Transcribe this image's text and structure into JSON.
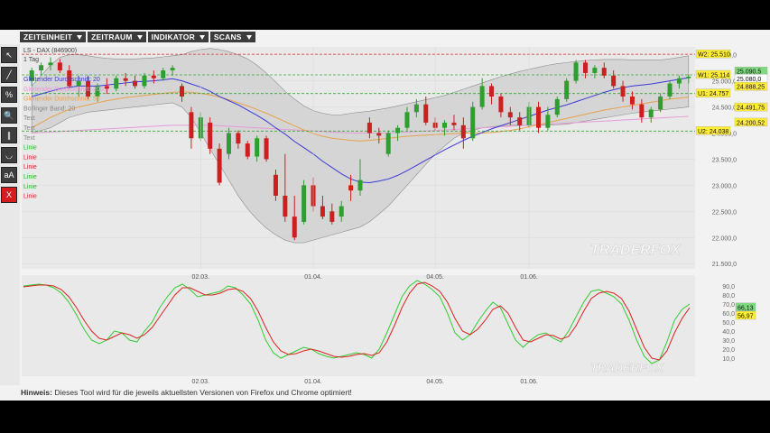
{
  "menu": [
    "ZEITEINHEIT",
    "ZEITRAUM",
    "INDIKATOR",
    "SCANS"
  ],
  "tools": [
    {
      "name": "cursor-icon",
      "glyph": "↖"
    },
    {
      "name": "line-tool-icon",
      "glyph": "╱"
    },
    {
      "name": "percent-tool-icon",
      "glyph": "%"
    },
    {
      "name": "zoom-icon",
      "glyph": "🔍"
    },
    {
      "name": "parallel-lines-icon",
      "glyph": "∥"
    },
    {
      "name": "arc-tool-icon",
      "glyph": "◡"
    },
    {
      "name": "text-tool-icon",
      "glyph": "aA"
    },
    {
      "name": "delete-icon",
      "glyph": "X"
    }
  ],
  "hint": {
    "label": "Hinweis:",
    "text": " Dieses Tool wird für die jeweils aktuellsten Versionen von Firefox und Chrome optimiert!"
  },
  "colors": {
    "up": "#2e9e2e",
    "down": "#cc1f1f",
    "sma20": "#3a3ad6",
    "sma200": "#e8a24a",
    "bollinger": "#bcbcbc",
    "stoch_k": "#33cc33",
    "stoch_d": "#dd2222",
    "pink": "#e89ad8"
  },
  "chart_data": {
    "type": "candlestick",
    "instrument": "LS - DAX (846900)",
    "timeframe": "1 Tag",
    "legend": [
      {
        "text": "Gleitender Durchschnitt: 20",
        "color": "#3a3ad6"
      },
      {
        "text": "Gleitender Durchschnitt: 200",
        "color": "#e89ad8"
      },
      {
        "text": "Gleitender Durchschnitt: 50",
        "color": "#e8a24a"
      },
      {
        "text": "Bollinger Band: 20",
        "color": "#888"
      },
      {
        "text": "Text",
        "color": "#888"
      },
      {
        "text": "Text",
        "color": "#888"
      },
      {
        "text": "Text",
        "color": "#888"
      },
      {
        "text": "Linie",
        "color": "#22bb22"
      },
      {
        "text": "Linie",
        "color": "#dd2222"
      },
      {
        "text": "Linie",
        "color": "#dd2222"
      },
      {
        "text": "Linie",
        "color": "#22bb22"
      },
      {
        "text": "Linie",
        "color": "#22bb22"
      },
      {
        "text": "Linie",
        "color": "#dd2222"
      }
    ],
    "x_labels": [
      "02.03.",
      "01.04.",
      "04.05.",
      "01.06."
    ],
    "x_label_index": [
      18,
      30,
      43,
      53
    ],
    "y_ticks": [
      21500,
      22000,
      22500,
      23000,
      23500,
      24000,
      24500,
      25000,
      25500
    ],
    "y_tick_labels": [
      "21.500,0",
      "22.000,0",
      "22.500,0",
      "23.000,0",
      "23.500,0",
      "24.000,0",
      "24.500,0",
      "25.000,0",
      "25.550,0"
    ],
    "ylim": [
      21400,
      25650
    ],
    "levels": [
      {
        "label": "W2: 25.510",
        "value": 25510,
        "color": "#dd3333",
        "bg": "#ffee33"
      },
      {
        "label": "W1: 25.114",
        "value": 25114,
        "color": "#33aa33",
        "bg": "#ffee33"
      },
      {
        "label": "U1: 24.757",
        "value": 24757,
        "color": "#33aa33",
        "bg": "#ffee33"
      },
      {
        "label": "U2: 24.038",
        "value": 24038,
        "color": "#33aa33",
        "bg": "#ffee33"
      }
    ],
    "price_tags": [
      {
        "label": "25.090,5",
        "value": 25180,
        "bg": "#7fd97f"
      },
      {
        "label": "25.080,0",
        "value": 25040,
        "bg": "#ffffff"
      },
      {
        "label": "24.888,25",
        "value": 24888,
        "bg": "#ffee33"
      },
      {
        "label": "24.491,75",
        "value": 24491,
        "bg": "#ffee33"
      },
      {
        "label": "24.200,52",
        "value": 24200,
        "bg": "#ffee33"
      }
    ],
    "candles": [
      [
        25000,
        25250,
        24900,
        25200
      ],
      [
        25200,
        25350,
        25100,
        25300
      ],
      [
        25300,
        25450,
        25200,
        25350
      ],
      [
        25350,
        25420,
        25150,
        25200
      ],
      [
        25200,
        25300,
        24850,
        24900
      ],
      [
        24900,
        25100,
        24700,
        25000
      ],
      [
        25000,
        25100,
        24650,
        24700
      ],
      [
        24700,
        24950,
        24600,
        24900
      ],
      [
        24900,
        25050,
        24750,
        24850
      ],
      [
        24850,
        25100,
        24800,
        25050
      ],
      [
        25050,
        25150,
        24900,
        25000
      ],
      [
        25000,
        25100,
        24850,
        24900
      ],
      [
        24900,
        25150,
        24850,
        25100
      ],
      [
        25100,
        25200,
        24950,
        25050
      ],
      [
        25050,
        25250,
        25000,
        25200
      ],
      [
        25200,
        25300,
        25100,
        25250
      ],
      [
        24900,
        24950,
        24600,
        24700
      ],
      [
        24400,
        24500,
        23700,
        23900
      ],
      [
        23900,
        24400,
        23850,
        24300
      ],
      [
        24200,
        24300,
        23600,
        23700
      ],
      [
        23700,
        23800,
        23000,
        23050
      ],
      [
        23600,
        24100,
        23500,
        24000
      ],
      [
        24000,
        24050,
        23700,
        23800
      ],
      [
        23800,
        23850,
        23500,
        23550
      ],
      [
        23550,
        23950,
        23450,
        23900
      ],
      [
        23900,
        23950,
        23450,
        23500
      ],
      [
        23200,
        23300,
        22700,
        22800
      ],
      [
        22800,
        23600,
        22300,
        22400
      ],
      [
        22400,
        22800,
        21950,
        22000
      ],
      [
        22300,
        23100,
        22250,
        23000
      ],
      [
        23000,
        23150,
        22500,
        22600
      ],
      [
        22600,
        22800,
        22350,
        22400
      ],
      [
        22500,
        22650,
        22250,
        22300
      ],
      [
        22400,
        22700,
        22300,
        22600
      ],
      [
        23000,
        23200,
        22700,
        22900
      ],
      [
        22900,
        23500,
        22800,
        23100
      ],
      [
        24200,
        24300,
        23900,
        24000
      ],
      [
        24000,
        24100,
        23800,
        23950
      ],
      [
        23600,
        24050,
        23550,
        24000
      ],
      [
        24000,
        24150,
        23850,
        24100
      ],
      [
        24100,
        24500,
        24050,
        24400
      ],
      [
        24400,
        24650,
        24300,
        24550
      ],
      [
        24550,
        24700,
        24150,
        24200
      ],
      [
        24200,
        24300,
        24050,
        24100
      ],
      [
        24100,
        24250,
        23950,
        24200
      ],
      [
        24200,
        24350,
        24050,
        24150
      ],
      [
        24150,
        24300,
        23700,
        23900
      ],
      [
        23900,
        24600,
        23850,
        24500
      ],
      [
        24500,
        25050,
        24450,
        24900
      ],
      [
        24900,
        24950,
        24550,
        24700
      ],
      [
        24700,
        24750,
        24300,
        24400
      ],
      [
        24400,
        24500,
        24150,
        24300
      ],
      [
        24300,
        24400,
        24050,
        24150
      ],
      [
        24150,
        24600,
        24100,
        24500
      ],
      [
        24500,
        24600,
        24000,
        24100
      ],
      [
        24100,
        24500,
        24050,
        24350
      ],
      [
        24350,
        24700,
        24300,
        24650
      ],
      [
        24650,
        25050,
        24600,
        25000
      ],
      [
        25000,
        25400,
        24950,
        25350
      ],
      [
        25350,
        25400,
        25050,
        25150
      ],
      [
        25150,
        25300,
        25050,
        25250
      ],
      [
        25250,
        25350,
        25050,
        25100
      ],
      [
        25100,
        25200,
        24850,
        24900
      ],
      [
        24900,
        25000,
        24600,
        24700
      ],
      [
        24700,
        24800,
        24450,
        24550
      ],
      [
        24550,
        24650,
        24200,
        24300
      ],
      [
        24300,
        24500,
        24200,
        24450
      ],
      [
        24450,
        24750,
        24400,
        24700
      ],
      [
        24700,
        25000,
        24650,
        24950
      ],
      [
        24950,
        25100,
        24850,
        25050
      ],
      [
        25050,
        25120,
        24950,
        25080
      ]
    ],
    "sma20": [
      24700,
      24750,
      24800,
      24850,
      24880,
      24900,
      24900,
      24900,
      24920,
      24940,
      24960,
      24980,
      24990,
      25000,
      25020,
      25040,
      25000,
      24940,
      24880,
      24800,
      24700,
      24620,
      24540,
      24440,
      24340,
      24230,
      24100,
      23980,
      23840,
      23720,
      23600,
      23460,
      23340,
      23220,
      23120,
      23060,
      23050,
      23080,
      23120,
      23190,
      23280,
      23380,
      23480,
      23580,
      23680,
      23770,
      23860,
      23940,
      24010,
      24080,
      24140,
      24200,
      24260,
      24320,
      24380,
      24440,
      24490,
      24540,
      24600,
      24660,
      24720,
      24780,
      24830,
      24870,
      24900,
      24920,
      24940,
      24970,
      25000,
      25030,
      25060
    ],
    "sma50": [
      24100,
      24200,
      24300,
      24380,
      24450,
      24500,
      24540,
      24580,
      24620,
      24650,
      24680,
      24700,
      24720,
      24740,
      24760,
      24780,
      24790,
      24780,
      24760,
      24730,
      24690,
      24640,
      24580,
      24520,
      24450,
      24380,
      24300,
      24220,
      24140,
      24060,
      23990,
      23940,
      23900,
      23880,
      23860,
      23850,
      23860,
      23880,
      23900,
      23920,
      23940,
      23950,
      23960,
      23970,
      23980,
      23990,
      24000,
      24000,
      24000,
      24010,
      24030,
      24050,
      24080,
      24120,
      24160,
      24200,
      24240,
      24280,
      24320,
      24360,
      24400,
      24440,
      24470,
      24500,
      24530,
      24560,
      24590,
      24620,
      24650,
      24670,
      24690
    ],
    "sma200": [
      24000,
      24010,
      24020,
      24030,
      24040,
      24050,
      24060,
      24070,
      24080,
      24090,
      24100,
      24110,
      24120,
      24130,
      24140,
      24150,
      24150,
      24150,
      24150,
      24150,
      24140,
      24130,
      24120,
      24110,
      24100,
      24090,
      24080,
      24070,
      24060,
      24050,
      24040,
      24030,
      24020,
      24010,
      24000,
      24000,
      24000,
      24000,
      24000,
      24010,
      24020,
      24030,
      24040,
      24050,
      24060,
      24070,
      24080,
      24090,
      24100,
      24110,
      24120,
      24130,
      24140,
      24150,
      24160,
      24170,
      24180,
      24190,
      24200,
      24210,
      24220,
      24230,
      24240,
      24250,
      24260,
      24270,
      24280,
      24290,
      24300,
      24310,
      24320
    ],
    "bb_upper": [
      24900,
      25100,
      25300,
      25450,
      25500,
      25500,
      25480,
      25450,
      25430,
      25420,
      25420,
      25420,
      25430,
      25440,
      25460,
      25480,
      25500,
      25560,
      25600,
      25620,
      25600,
      25560,
      25500,
      25420,
      25300,
      25150,
      24980,
      24800,
      24650,
      24520,
      24430,
      24380,
      24350,
      24350,
      24380,
      24400,
      24420,
      24450,
      24480,
      24520,
      24560,
      24600,
      24640,
      24680,
      24720,
      24780,
      24840,
      24900,
      24960,
      25020,
      25080,
      25130,
      25180,
      25220,
      25260,
      25300,
      25330,
      25350,
      25370,
      25390,
      25400,
      25410,
      25410,
      25410,
      25400,
      25400,
      25400,
      25400,
      25420,
      25450,
      25480
    ],
    "bb_lower": [
      24000,
      24050,
      24100,
      24200,
      24300,
      24350,
      24400,
      24420,
      24440,
      24460,
      24480,
      24500,
      24520,
      24540,
      24560,
      24580,
      24500,
      24300,
      24000,
      23700,
      23400,
      23100,
      22800,
      22550,
      22350,
      22180,
      22050,
      21950,
      21900,
      21900,
      21950,
      22000,
      22050,
      22100,
      22150,
      22200,
      22300,
      22450,
      22600,
      22800,
      23000,
      23200,
      23400,
      23600,
      23750,
      23900,
      24000,
      24050,
      24100,
      24120,
      24140,
      24150,
      24150,
      24150,
      24150,
      24150,
      24160,
      24170,
      24200,
      24230,
      24260,
      24290,
      24320,
      24350,
      24380,
      24400,
      24420,
      24440,
      24460,
      24480,
      24500
    ],
    "stoch_k": [
      90,
      91,
      92,
      91,
      88,
      82,
      72,
      58,
      42,
      30,
      26,
      30,
      40,
      38,
      30,
      28,
      40,
      50,
      66,
      78,
      88,
      92,
      86,
      78,
      80,
      82,
      84,
      90,
      88,
      80,
      70,
      52,
      30,
      16,
      10,
      14,
      18,
      22,
      20,
      15,
      12,
      10,
      12,
      14,
      16,
      14,
      10,
      20,
      38,
      58,
      78,
      90,
      96,
      92,
      86,
      78,
      60,
      38,
      30,
      36,
      50,
      62,
      72,
      66,
      48,
      30,
      22,
      30,
      36,
      38,
      32,
      28,
      40,
      56,
      72,
      84,
      86,
      82,
      78,
      70,
      52,
      30,
      12,
      4,
      8,
      28,
      52,
      64,
      70
    ],
    "stoch_d": [
      89,
      90,
      91,
      91,
      90,
      86,
      78,
      66,
      52,
      40,
      32,
      30,
      34,
      38,
      36,
      32,
      36,
      44,
      56,
      68,
      80,
      88,
      88,
      84,
      80,
      80,
      82,
      86,
      87,
      84,
      76,
      62,
      44,
      28,
      18,
      14,
      15,
      18,
      20,
      18,
      15,
      12,
      11,
      12,
      14,
      15,
      13,
      16,
      28,
      46,
      66,
      82,
      92,
      94,
      90,
      84,
      72,
      54,
      40,
      36,
      42,
      52,
      64,
      68,
      60,
      44,
      30,
      28,
      32,
      36,
      35,
      31,
      34,
      46,
      62,
      76,
      82,
      84,
      82,
      76,
      62,
      42,
      22,
      10,
      8,
      18,
      38,
      54,
      66
    ],
    "stoch_yticks": [
      "90,0",
      "80,0",
      "70,0",
      "60,0",
      "50,0",
      "40,0",
      "30,0",
      "20,0",
      "10,0"
    ],
    "stoch_values": [
      {
        "label": "66,13",
        "bg": "#7fd97f",
        "value": 66.13
      },
      {
        "label": "56,97",
        "bg": "#ffee33",
        "value": 56.97
      }
    ],
    "watermark": "TRADERFOX"
  }
}
